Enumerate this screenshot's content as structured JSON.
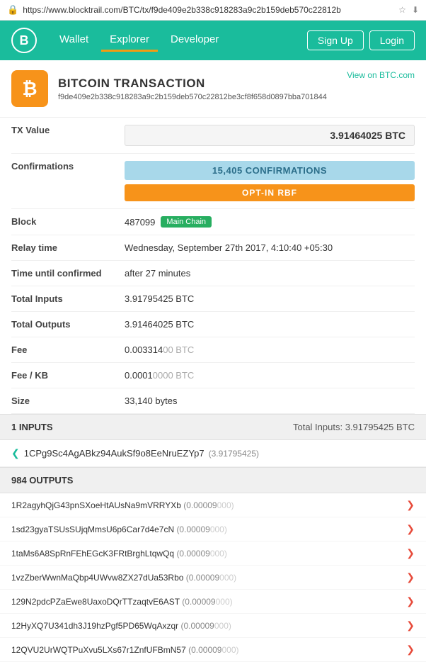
{
  "url": "https://www.blocktrail.com/BTC/tx/f9de409e2b338c918283a9c2b159deb570c22812b",
  "nav": {
    "logo": "B",
    "links": [
      "Wallet",
      "Explorer",
      "Developer"
    ],
    "active_link": "Explorer",
    "right_buttons": [
      "Sign Up",
      "Login"
    ]
  },
  "transaction": {
    "icon": "₿",
    "title": "BITCOIN TRANSACTION",
    "view_link_label": "View on BTC.com",
    "hash": "f9de409e2b338c918283a9c2b159deb570c22812be3cf8f658d0897bba701844",
    "tx_value": "3.91464025 BTC",
    "confirmations": "15,405 CONFIRMATIONS",
    "rbf_label": "OPT-IN RBF",
    "block_number": "487099",
    "block_badge": "Main Chain",
    "relay_time": "Wednesday, September 27th 2017, 4:10:40 +05:30",
    "time_until_confirmed": "after 27 minutes",
    "total_inputs": "3.91795425 BTC",
    "total_outputs": "3.91464025 BTC",
    "fee_main": "0.003314",
    "fee_dim": "00 BTC",
    "fee_kb_main": "0.0001",
    "fee_kb_dim": "0000 BTC",
    "size": "33,140 bytes"
  },
  "labels": {
    "tx_value": "TX Value",
    "confirmations": "Confirmations",
    "block": "Block",
    "relay_time": "Relay time",
    "time_until_confirmed": "Time until confirmed",
    "total_inputs": "Total Inputs",
    "total_outputs": "Total Outputs",
    "fee": "Fee",
    "fee_kb": "Fee / KB",
    "size": "Size"
  },
  "inputs_section": {
    "title": "1 INPUTS",
    "total_label": "Total Inputs: 3.91795425 BTC",
    "items": [
      {
        "address": "1CPg9Sc4AgABkz94AukSf9o8EeNruEZYp7",
        "amount": "(3.91795425)"
      }
    ]
  },
  "outputs_section": {
    "title": "984 OUTPUTS",
    "items": [
      {
        "address": "1R2agyhQjG43pnSXoeHtAUsNa9mVRRYXb",
        "amount_main": "(0.00009",
        "amount_dim": "000)"
      },
      {
        "address": "1sd23gyaTSUsSUjqMmsU6p6Car7d4e7cN",
        "amount_main": "(0.00009",
        "amount_dim": "000)"
      },
      {
        "address": "1taMs6A8SpRnFEhEGcK3FRtBrghLtqwQq",
        "amount_main": "(0.00009",
        "amount_dim": "000)"
      },
      {
        "address": "1vzZberWwnMaQbp4UWvw8ZX27dUa53Rbo",
        "amount_main": "(0.00009",
        "amount_dim": "000)"
      },
      {
        "address": "129N2pdcPZaEwe8UaxoDQrTTzaqtvE6AST",
        "amount_main": "(0.00009",
        "amount_dim": "000)"
      },
      {
        "address": "12HyXQ7U341dh3J19hzPgf5PD65WqAxzqr",
        "amount_main": "(0.00009",
        "amount_dim": "000)"
      },
      {
        "address": "12QVU2UrWQTPuXvu5LXs67r1ZnfUFBmN57",
        "amount_main": "(0.00009",
        "amount_dim": "000)"
      }
    ]
  }
}
